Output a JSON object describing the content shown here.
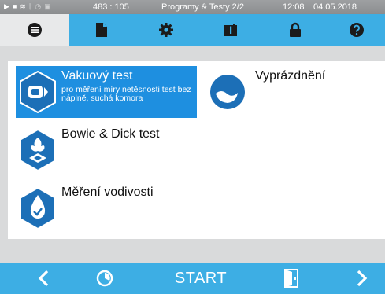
{
  "status_bar": {
    "coords": "483 : 105",
    "title": "Programy & Testy 2/2",
    "time": "12:08",
    "date": "04.05.2018",
    "icons": [
      "play-icon",
      "document-icon",
      "steam-icon",
      "chart-icon",
      "clock-icon",
      "lock-icon"
    ]
  },
  "tabs": [
    {
      "name": "menu-list",
      "icon": "list-icon",
      "active": true
    },
    {
      "name": "documents",
      "icon": "document-icon"
    },
    {
      "name": "settings",
      "icon": "gear-icon"
    },
    {
      "name": "info",
      "icon": "info-icon"
    },
    {
      "name": "lock",
      "icon": "lock-icon"
    },
    {
      "name": "help",
      "icon": "help-icon"
    }
  ],
  "programs": {
    "vacuum": {
      "label": "Vakuový test",
      "description": "pro měření míry netěsnosti test bez náplně, suchá komora",
      "selected": true
    },
    "drain": {
      "label": "Vyprázdnění"
    },
    "bowie_dick": {
      "label": "Bowie & Dick test"
    },
    "conductivity": {
      "label": "Měření vodivosti"
    }
  },
  "bottom_bar": {
    "start_label": "START",
    "icons": [
      "chevron-left-icon",
      "timer-icon",
      "door-icon",
      "chevron-right-icon"
    ]
  },
  "colors": {
    "accent": "#3daee4",
    "selected": "#1e8fe0",
    "icon_dark": "#1c6fb7",
    "status_bar": "#8f9193",
    "background": "#d9dadb"
  }
}
